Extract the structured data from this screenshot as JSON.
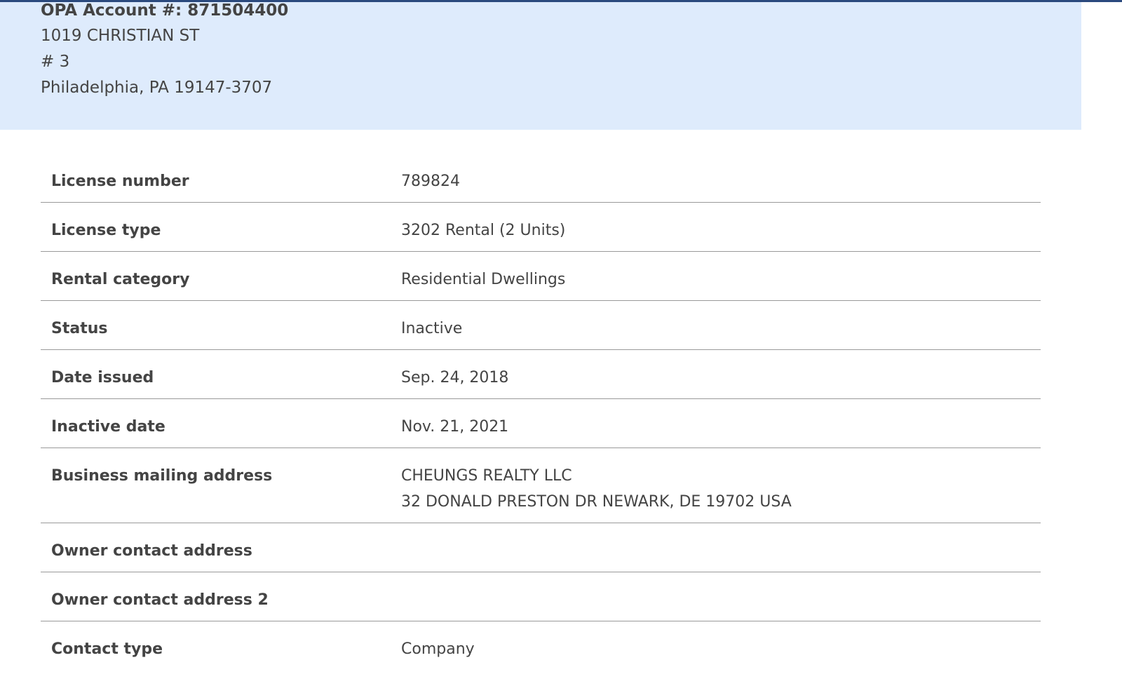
{
  "header": {
    "opa_account": "OPA Account #: 871504400",
    "address_line1": "1019 CHRISTIAN ST",
    "address_line2": "# 3",
    "address_line3": "Philadelphia, PA 19147-3707"
  },
  "details": {
    "license_number": {
      "label": "License number",
      "value": "789824"
    },
    "license_type": {
      "label": "License type",
      "value": "3202 Rental (2 Units)"
    },
    "rental_category": {
      "label": "Rental category",
      "value": "Residential Dwellings"
    },
    "status": {
      "label": "Status",
      "value": "Inactive"
    },
    "date_issued": {
      "label": "Date issued",
      "value": "Sep. 24, 2018"
    },
    "inactive_date": {
      "label": "Inactive date",
      "value": "Nov. 21, 2021"
    },
    "business_mailing_address": {
      "label": "Business mailing address",
      "value_line1": "CHEUNGS REALTY LLC",
      "value_line2": "32 DONALD PRESTON DR NEWARK, DE 19702 USA"
    },
    "owner_contact_address": {
      "label": "Owner contact address",
      "value": ""
    },
    "owner_contact_address_2": {
      "label": "Owner contact address 2",
      "value": ""
    },
    "contact_type": {
      "label": "Contact type",
      "value": "Company"
    }
  },
  "colors": {
    "top_bar": "#2b4a7e",
    "address_panel_bg": "#deebfc",
    "text": "#444444",
    "divider": "#9a9a9a"
  }
}
